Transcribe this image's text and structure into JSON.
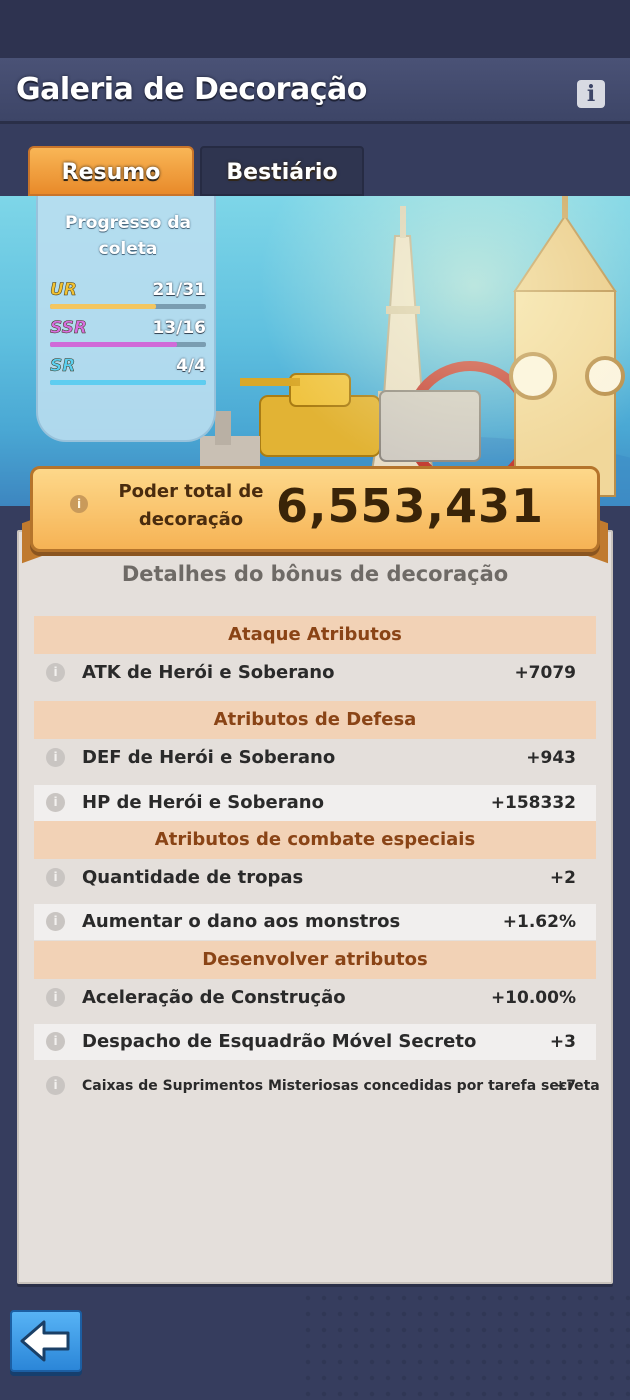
{
  "header": {
    "title": "Galeria de Decoração",
    "info_icon": "info-icon"
  },
  "tabs": [
    {
      "label": "Resumo",
      "active": true
    },
    {
      "label": "Bestiário",
      "active": false
    }
  ],
  "collection": {
    "title": "Progresso da coleta",
    "rarities": [
      {
        "label": "UR",
        "count": "21/31",
        "progress": 0.677,
        "color": "#f1c232",
        "bar_color": "#f3c660"
      },
      {
        "label": "SSR",
        "count": "13/16",
        "progress": 0.8125,
        "color": "#d76ee0",
        "bar_color": "#d06ad8"
      },
      {
        "label": "SR",
        "count": "4/4",
        "progress": 1.0,
        "color": "#5bd0f0",
        "bar_color": "#5ecdf0"
      }
    ]
  },
  "power": {
    "label": "Poder total de decoração",
    "value": "6,553,431"
  },
  "bonus": {
    "title": "Detalhes do bônus de decoração",
    "sections": [
      {
        "header": "Ataque Atributos"
      },
      {
        "header": "Atributos de Defesa"
      },
      {
        "header": "Atributos de combate especiais"
      },
      {
        "header": "Desenvolver atributos"
      }
    ],
    "rows": [
      {
        "label": "ATK de Herói e Soberano",
        "value": "+7079"
      },
      {
        "label": "DEF de Herói e Soberano",
        "value": "+943"
      },
      {
        "label": "HP de Herói e Soberano",
        "value": "+158332"
      },
      {
        "label": "Quantidade de tropas",
        "value": "+2"
      },
      {
        "label": "Aumentar o dano aos monstros",
        "value": "+1.62%"
      },
      {
        "label": "Aceleração de Construção",
        "value": "+10.00%"
      },
      {
        "label": "Despacho de Esquadrão Móvel Secreto",
        "value": "+3"
      },
      {
        "label": "Caixas de Suprimentos Misteriosas concedidas por tarefa secreta",
        "value": "+7"
      }
    ]
  },
  "back_button": {
    "icon": "back-arrow-icon"
  }
}
